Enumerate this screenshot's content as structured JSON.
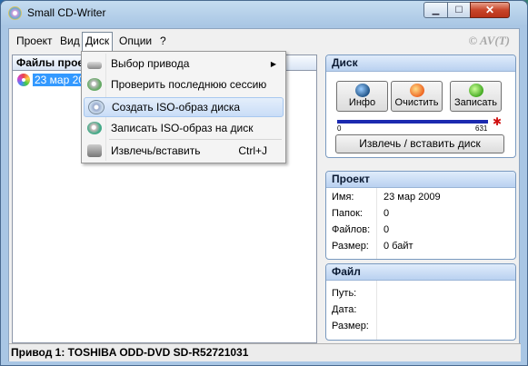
{
  "window": {
    "title": "Small CD-Writer"
  },
  "menubar": {
    "items": [
      "Проект",
      "Вид",
      "Диск",
      "Опции",
      "?"
    ],
    "copyright": "© AV(T)"
  },
  "tree": {
    "header": "Файлы проекта",
    "item": "23 мар 2009"
  },
  "dropdown": {
    "items": [
      {
        "label": "Выбор привода",
        "icon": "drive-icon",
        "submenu": true
      },
      {
        "label": "Проверить последнюю сессию",
        "icon": "check-session-icon"
      },
      {
        "label": "Создать ISO-образ диска",
        "icon": "iso-disc-icon"
      },
      {
        "label": "Записать ISO-образ на диск",
        "icon": "burn-iso-icon"
      },
      {
        "label": "Извлечь/вставить",
        "icon": "eject-icon",
        "shortcut": "Ctrl+J"
      }
    ]
  },
  "disk": {
    "title": "Диск",
    "buttons": [
      "Инфо",
      "Очистить",
      "Записать"
    ],
    "progress_min": "0",
    "progress_max": "631",
    "eject_label": "Извлечь / вставить диск"
  },
  "project": {
    "title": "Проект",
    "fields": [
      {
        "key": "Имя:",
        "value": "23 мар 2009"
      },
      {
        "key": "Папок:",
        "value": "0"
      },
      {
        "key": "Файлов:",
        "value": "0"
      },
      {
        "key": "Размер:",
        "value": "0 байт"
      }
    ]
  },
  "file": {
    "title": "Файл",
    "fields": [
      {
        "key": "Путь:",
        "value": ""
      },
      {
        "key": "Дата:",
        "value": ""
      },
      {
        "key": "Размер:",
        "value": ""
      }
    ]
  },
  "status": {
    "text": "Привод 1: TOSHIBA ODD-DVD SD-R52721031"
  }
}
